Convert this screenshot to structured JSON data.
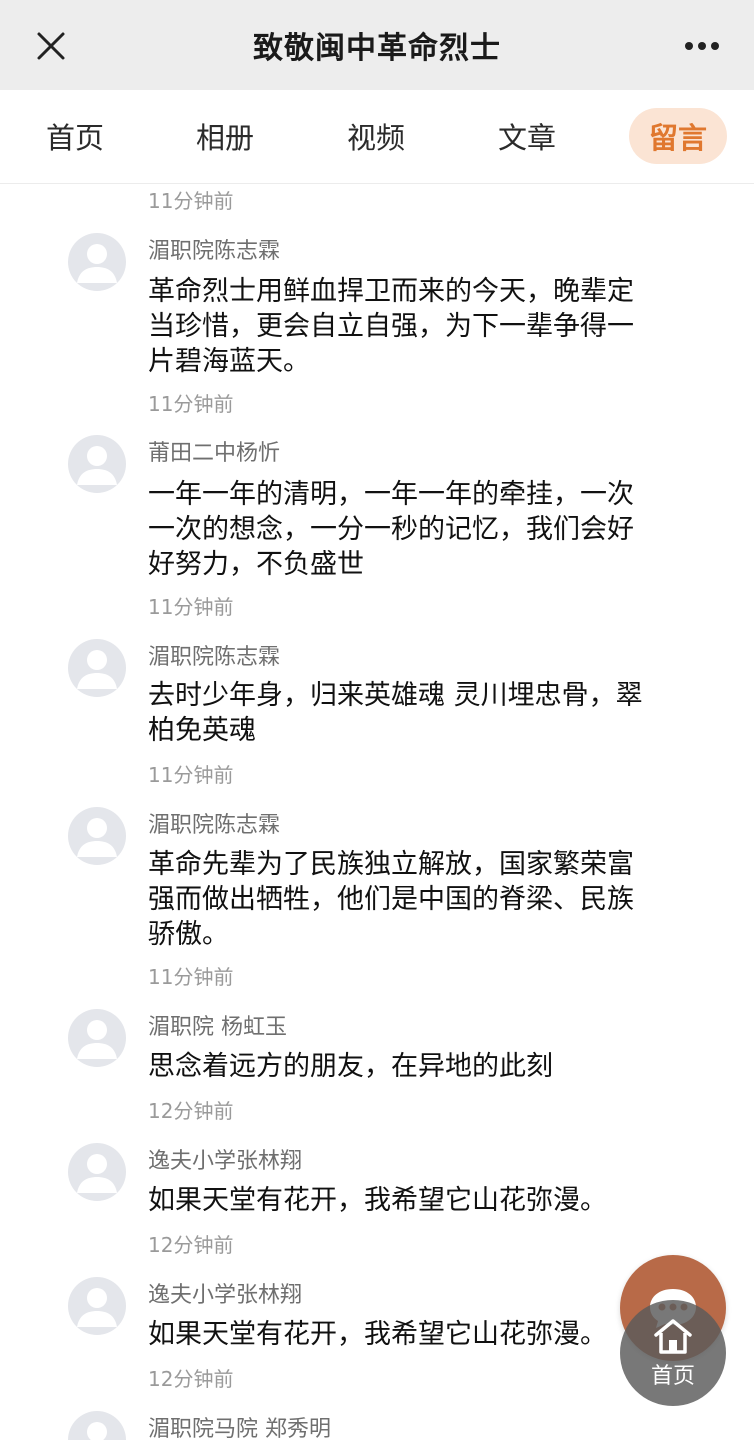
{
  "header": {
    "title": "致敬闽中革命烈士"
  },
  "tabs": [
    {
      "label": "首页",
      "active": false
    },
    {
      "label": "相册",
      "active": false
    },
    {
      "label": "视频",
      "active": false
    },
    {
      "label": "文章",
      "active": false
    },
    {
      "label": "留言",
      "active": true
    }
  ],
  "first_time": "11分钟前",
  "comments": [
    {
      "name": "湄职院陈志霖",
      "text": "革命烈士用鲜血捍卫而来的今天，晚辈定当珍惜，更会自立自强，为下一辈争得一片碧海蓝天。",
      "time": "11分钟前"
    },
    {
      "name": "莆田二中杨忻",
      "text": "一年一年的清明，一年一年的牵挂，一次一次的想念，一分一秒的记忆，我们会好好努力，不负盛世",
      "time": "11分钟前"
    },
    {
      "name": "湄职院陈志霖",
      "text": "去时少年身，归来英雄魂 灵川埋忠骨，翠柏免英魂",
      "time": "11分钟前"
    },
    {
      "name": "湄职院陈志霖",
      "text": "革命先辈为了民族独立解放，国家繁荣富强而做出牺牲，他们是中国的脊梁、民族骄傲。",
      "time": "11分钟前"
    },
    {
      "name": "湄职院 杨虹玉",
      "text": "思念着远方的朋友，在异地的此刻",
      "time": "12分钟前"
    },
    {
      "name": "逸夫小学张林翔",
      "text": "如果天堂有花开，我希望它山花弥漫。",
      "time": "12分钟前"
    },
    {
      "name": "逸夫小学张林翔",
      "text": "如果天堂有花开，我希望它山花弥漫。",
      "time": "12分钟前"
    },
    {
      "name": "湄职院马院 郑秀明",
      "text": "",
      "time": ""
    }
  ],
  "fab": {
    "home_label": "首页"
  },
  "colors": {
    "accent": "#e0782f",
    "tab_active_bg": "#fbe4d4",
    "fab_message": "#b86a48"
  }
}
